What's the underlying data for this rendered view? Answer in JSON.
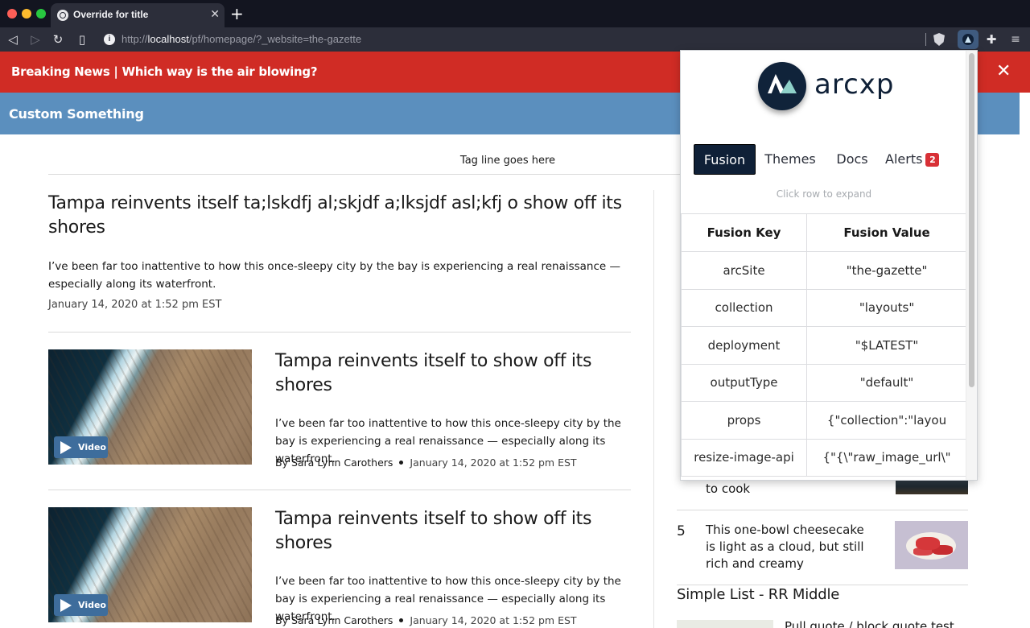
{
  "browser": {
    "tab_title": "Override for title",
    "tab_close": "✕",
    "new_tab": "+",
    "url_scheme": "http://",
    "url_host": "localhost",
    "url_path": "/pf/homepage/?_website=the-gazette"
  },
  "alert_bar": {
    "text": "Breaking News | Which way is the air blowing?",
    "close": "✕"
  },
  "nav": {
    "title": "Custom Something"
  },
  "tagline": "Tag line goes here",
  "lead_story": {
    "title": "Tampa reinvents itself ta;lskdfj al;skjdf a;lksjdf asl;kfj o show off its shores",
    "description": "I’ve been far too inattentive to how this once-sleepy city by the bay is experiencing a real renaissance — especially along its waterfront.",
    "date": "January 14, 2020 at 1:52 pm EST"
  },
  "stories": [
    {
      "title": "Tampa reinvents itself to show off its shores",
      "description": "I’ve been far too inattentive to how this once-sleepy city by the bay is experiencing a real renaissance — especially along its waterfront.",
      "byline": "By Sara Lynn Carothers",
      "date": "January 14, 2020 at 1:52 pm EST",
      "video_label": "Video"
    },
    {
      "title": "Tampa reinvents itself to show off its shores",
      "description": "I’ve been far too inattentive to how this once-sleepy city by the bay is experiencing a real renaissance — especially along its waterfront.",
      "byline": "By Sara Lynn Carothers",
      "date": "January 14, 2020 at 1:52 pm EST",
      "video_label": "Video"
    }
  ],
  "right_rail": {
    "item4_tail": "to cook",
    "item5": {
      "number": "5",
      "title": "This one-bowl cheesecake is light as a cloud, but still rich and creamy"
    },
    "simple_list_heading": "Simple List - RR Middle",
    "simple_list_first": "Pull quote / block quote test"
  },
  "popup": {
    "logo_text": "arcxp",
    "tabs": {
      "fusion": "Fusion",
      "themes": "Themes",
      "docs": "Docs",
      "alerts": "Alerts",
      "alerts_count": "2"
    },
    "hint": "Click row to expand",
    "table": {
      "headers": [
        "Fusion Key",
        "Fusion Value"
      ],
      "rows": [
        {
          "key": "arcSite",
          "value": "\"the-gazette\""
        },
        {
          "key": "collection",
          "value": "\"layouts\""
        },
        {
          "key": "deployment",
          "value": "\"$LATEST\""
        },
        {
          "key": "outputType",
          "value": "\"default\""
        },
        {
          "key": "props",
          "value": "{\"collection\":\"layou"
        },
        {
          "key": "resize-image-api",
          "value": "{\"{\\\"raw_image_url\\\""
        }
      ]
    }
  },
  "colors": {
    "alert_bg": "#d02c25",
    "nav_bg": "#5b8fbe",
    "popup_active_tab": "#0f2037",
    "badge": "#d83036"
  }
}
